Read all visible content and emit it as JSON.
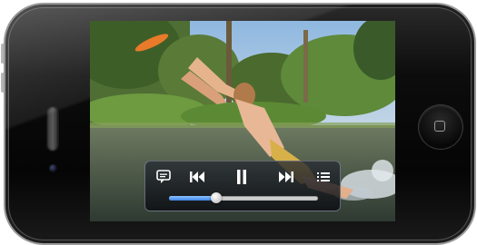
{
  "device": {
    "type": "phone",
    "orientation": "landscape"
  },
  "video": {
    "scene": "person-leaping-into-river-with-frisbee"
  },
  "controls": {
    "subtitles_icon": "speech-bubble-icon",
    "previous_icon": "skip-back-icon",
    "play_pause_icon": "pause-icon",
    "next_icon": "skip-forward-icon",
    "chapters_icon": "list-icon",
    "progress_fraction": 0.32
  },
  "colors": {
    "scrubber_fill": "#3f86ea",
    "controls_background": "#1a1d23"
  }
}
